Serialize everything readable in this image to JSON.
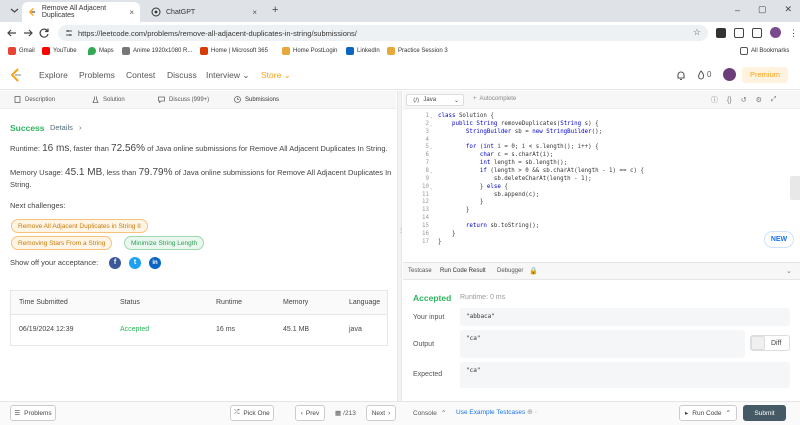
{
  "browser": {
    "tabs": [
      {
        "title": "Remove All Adjacent Duplicates",
        "close": "×"
      },
      {
        "title": "ChatGPT",
        "close": "×"
      }
    ],
    "new_tab": "+",
    "url": "https://leetcode.com/problems/remove-all-adjacent-duplicates-in-string/submissions/",
    "bookmarks": [
      "Gmail",
      "YouTube",
      "Maps",
      "Anime 1920x1080 R...",
      "Home | Microsoft 365",
      "Home PostLogin",
      "LinkedIn",
      "Practice Session 3"
    ],
    "all_bookmarks": "All Bookmarks"
  },
  "header": {
    "nav": [
      "Explore",
      "Problems",
      "Contest",
      "Discuss",
      "Interview ⌄",
      "Store ⌄"
    ],
    "notif_count": "0",
    "premium": "Premium"
  },
  "left": {
    "tabs": [
      "Description",
      "Solution",
      "Discuss (999+)",
      "Submissions"
    ],
    "status": "Success",
    "details": "Details",
    "runtime": {
      "label": "Runtime:",
      "value": "16 ms",
      "mid": ", faster than",
      "pct": "72.56%",
      "tail": "of Java online submissions for Remove All Adjacent Duplicates In String."
    },
    "memory": {
      "label": "Memory Usage:",
      "value": "45.1 MB",
      "mid": ", less than",
      "pct": "79.79%",
      "tail": "of Java online submissions for Remove All Adjacent Duplicates In",
      "tail2": "String."
    },
    "next_label": "Next challenges:",
    "challenges": [
      "Remove All Adjacent Duplicates in String II",
      "Removing Stars From a String",
      "Minimize String Length"
    ],
    "show_off": "Show off your acceptance:",
    "table": {
      "headers": [
        "Time Submitted",
        "Status",
        "Runtime",
        "Memory",
        "Language"
      ],
      "row": [
        "06/19/2024 12:39",
        "Accepted",
        "16 ms",
        "45.1 MB",
        "java"
      ]
    }
  },
  "editor": {
    "language": "Java",
    "autocomplete": "Autocomplete",
    "lines": [
      "class Solution {",
      "    public String removeDuplicates(String s) {",
      "        StringBuilder sb = new StringBuilder();",
      "",
      "        for (int i = 0; i < s.length(); i++) {",
      "            char c = s.charAt(i);",
      "            int length = sb.length();",
      "            if (length > 0 && sb.charAt(length - 1) == c) {",
      "                sb.deleteCharAt(length - 1);",
      "            } else {",
      "                sb.append(c);",
      "            }",
      "        }",
      "",
      "        return sb.toString();",
      "    }",
      "}"
    ],
    "new_badge": "NEW"
  },
  "console": {
    "tabs": [
      "Testcase",
      "Run Code Result",
      "Debugger"
    ],
    "status": "Accepted",
    "runtime": "Runtime: 0 ms",
    "your_input_label": "Your input",
    "your_input": "\"abbaca\"",
    "output_label": "Output",
    "output": "\"ca\"",
    "diff": "Diff",
    "expected_label": "Expected",
    "expected": "\"ca\""
  },
  "bottom": {
    "problems": "Problems",
    "pick_one": "Pick One",
    "prev": "Prev",
    "page": "/213",
    "next": "Next",
    "console": "Console",
    "use_example": "Use Example Testcases",
    "run_code": "Run Code",
    "submit": "Submit"
  },
  "colors": {
    "accent": "#ffa116",
    "success": "#2db55d",
    "submit": "#455a64"
  }
}
